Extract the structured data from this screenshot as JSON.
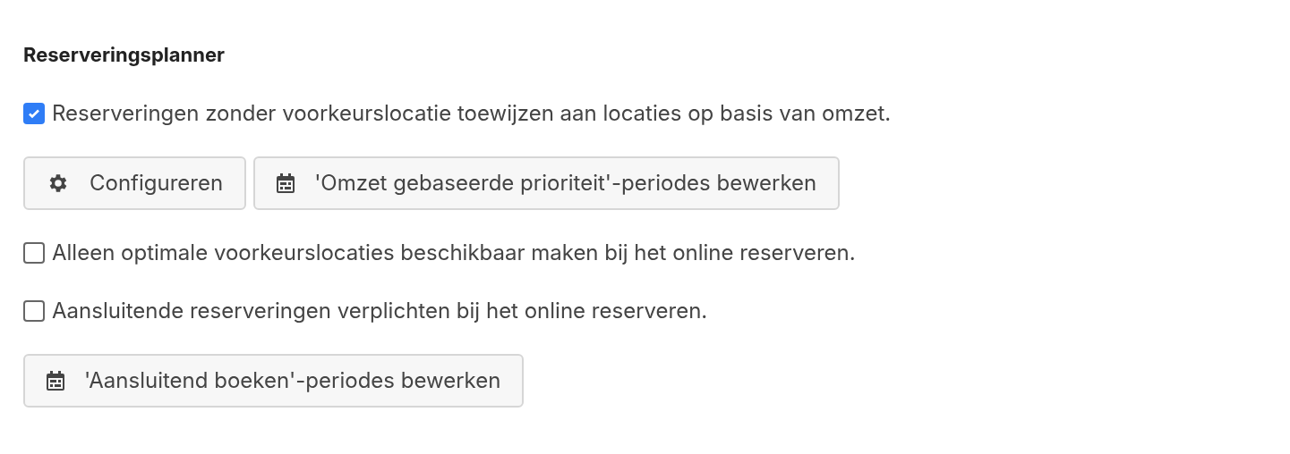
{
  "title": "Reserveringsplanner",
  "items": [
    {
      "kind": "checkbox",
      "label": "Reserveringen zonder voorkeurslocatie toewijzen aan locaties op basis van omzet.",
      "checked": true
    },
    {
      "kind": "buttons",
      "buttons": [
        {
          "kind": "gear",
          "label": "Configureren"
        },
        {
          "kind": "calendar",
          "label": "'Omzet gebaseerde prioriteit'-periodes bewerken"
        }
      ]
    },
    {
      "kind": "checkbox",
      "label": "Alleen optimale voorkeurslocaties beschikbaar maken bij het online reserveren.",
      "checked": false
    },
    {
      "kind": "checkbox",
      "label": "Aansluitende reserveringen verplichten bij het online reserveren.",
      "checked": false
    },
    {
      "kind": "buttons",
      "buttons": [
        {
          "kind": "calendar",
          "label": "'Aansluitend boeken'-periodes bewerken"
        }
      ]
    }
  ]
}
